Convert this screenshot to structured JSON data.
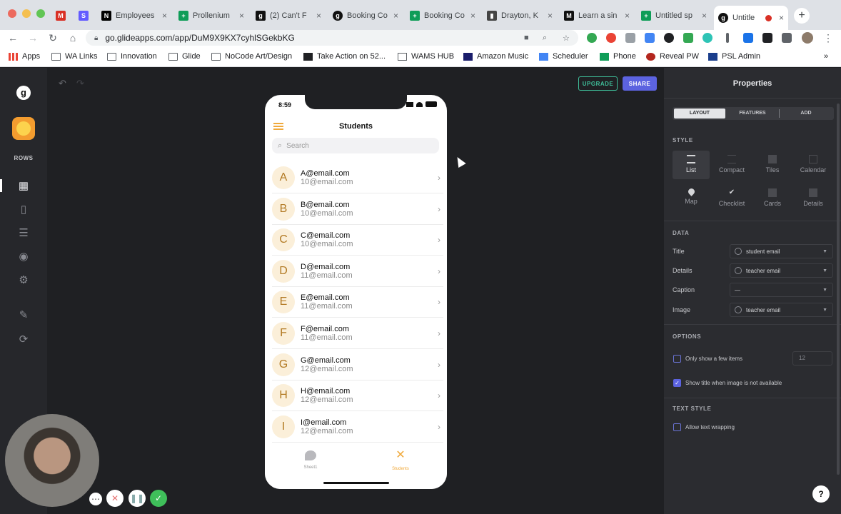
{
  "browser": {
    "tabs": [
      {
        "label": "",
        "icon": "gmail-icon",
        "color": "#d93025"
      },
      {
        "label": "",
        "icon": "stripe-icon",
        "color": "#635bff"
      },
      {
        "label": "Employees",
        "icon": "notion-icon",
        "color": "#000000"
      },
      {
        "label": "Prollenium",
        "icon": "sheets-icon",
        "color": "#0f9d58"
      },
      {
        "label": "(2) Can't F",
        "icon": "glide-icon",
        "color": "#111111"
      },
      {
        "label": "Booking Co",
        "icon": "glide-icon",
        "color": "#111111"
      },
      {
        "label": "Booking Co",
        "icon": "sheets-icon",
        "color": "#0f9d58"
      },
      {
        "label": "Drayton, K",
        "icon": "docs-icon",
        "color": "#444444"
      },
      {
        "label": "Learn a sin",
        "icon": "medium-icon",
        "color": "#111111"
      },
      {
        "label": "Untitled sp",
        "icon": "sheets-icon",
        "color": "#0f9d58"
      },
      {
        "label": "Untitle",
        "icon": "glide-icon",
        "color": "#111111"
      }
    ],
    "url": "go.glideapps.com/app/DuM9X9KX7cyhlSGekbKG",
    "bookmarks": [
      "Apps",
      "WA Links",
      "Innovation",
      "Glide",
      "NoCode Art/Design",
      "Take Action on 52...",
      "WAMS HUB",
      "Amazon Music",
      "Scheduler",
      "Phone",
      "Reveal PW",
      "PSL Admin"
    ],
    "more": "»"
  },
  "rail": {
    "logo": "g",
    "section_label": "ROWS"
  },
  "canvas": {
    "upgrade": "UPGRADE",
    "share": "SHARE"
  },
  "phone": {
    "time": "8:59",
    "title": "Students",
    "search_placeholder": "Search",
    "rows": [
      {
        "letter": "A",
        "title": "A@email.com",
        "detail": "10@email.com"
      },
      {
        "letter": "B",
        "title": "B@email.com",
        "detail": "10@email.com"
      },
      {
        "letter": "C",
        "title": "C@email.com",
        "detail": "10@email.com"
      },
      {
        "letter": "D",
        "title": "D@email.com",
        "detail": "11@email.com"
      },
      {
        "letter": "E",
        "title": "E@email.com",
        "detail": "11@email.com"
      },
      {
        "letter": "F",
        "title": "F@email.com",
        "detail": "11@email.com"
      },
      {
        "letter": "G",
        "title": "G@email.com",
        "detail": "12@email.com"
      },
      {
        "letter": "H",
        "title": "H@email.com",
        "detail": "12@email.com"
      },
      {
        "letter": "I",
        "title": "I@email.com",
        "detail": "12@email.com"
      }
    ],
    "tabbar": [
      {
        "label": "Sheet1",
        "active": false
      },
      {
        "label": "Students",
        "active": true
      }
    ],
    "accent": "#f0a93b"
  },
  "properties": {
    "title": "Properties",
    "tabs": [
      "LAYOUT",
      "FEATURES",
      "ADD"
    ],
    "style_heading": "STYLE",
    "styles": [
      "List",
      "Compact",
      "Tiles",
      "Calendar",
      "Map",
      "Checklist",
      "Cards",
      "Details"
    ],
    "data_heading": "DATA",
    "data": [
      {
        "label": "Title",
        "value": "student email",
        "icon": true
      },
      {
        "label": "Details",
        "value": "teacher email",
        "icon": true
      },
      {
        "label": "Caption",
        "value": "—",
        "icon": false
      },
      {
        "label": "Image",
        "value": "teacher email",
        "icon": true
      }
    ],
    "options_heading": "OPTIONS",
    "opt_few": "Only show a few items",
    "opt_few_count": "12",
    "opt_title": "Show title when image is not available",
    "text_heading": "TEXT STYLE",
    "opt_wrap": "Allow text wrapping",
    "help": "?"
  }
}
